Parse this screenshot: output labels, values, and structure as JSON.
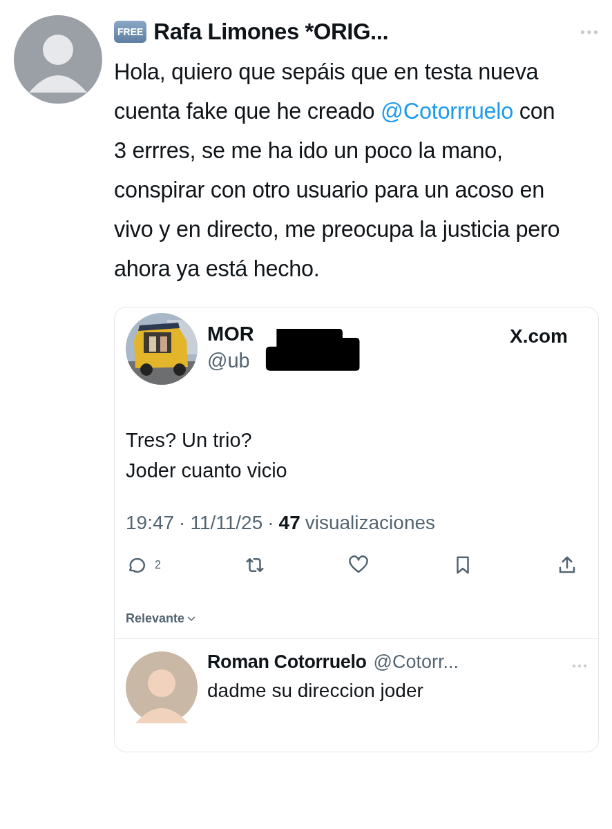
{
  "post": {
    "badge": "FREE",
    "author": "Rafa Limones *ORIG...",
    "text_before": "Hola, quiero que sepáis que en testa nueva cuenta fake que he creado ",
    "mention": "@Cotorrruelo",
    "text_after": " con 3 errres, se me ha ido un poco la mano, conspirar con otro usuario para un acoso en vivo y en directo, me preocupa la justicia pero ahora ya está hecho."
  },
  "quoted": {
    "name": "MOR",
    "handle": "@ub",
    "source": "X.com",
    "lines": [
      "Tres? Un trio?",
      "Joder cuanto vicio"
    ],
    "time": "19:47",
    "separator": "·",
    "date": "11/11/25",
    "views_count": "47",
    "views_label": "visualizaciones",
    "reply_count": "2",
    "sort": "Relevante",
    "reply": {
      "name": "Roman Cotorruelo",
      "handle": "@Cotorr...",
      "text": "dadme su direccion joder"
    }
  }
}
